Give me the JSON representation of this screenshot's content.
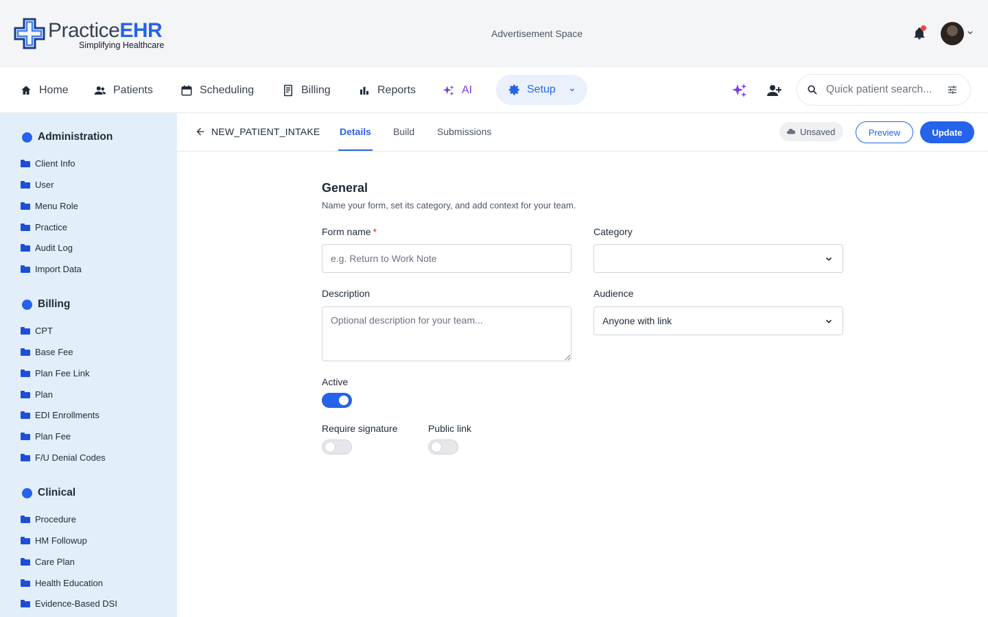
{
  "app": {
    "brand_practice": "Practice",
    "brand_ehr": "EHR",
    "tagline": "Simplifying Healthcare",
    "ad_space": "Advertisement Space"
  },
  "nav": {
    "home": "Home",
    "patients": "Patients",
    "scheduling": "Scheduling",
    "billing": "Billing",
    "reports": "Reports",
    "ai": "AI",
    "setup": "Setup",
    "search_placeholder": "Quick patient search..."
  },
  "sidebar": {
    "sections": [
      {
        "title": "Administration",
        "items": [
          "Client Info",
          "User",
          "Menu Role",
          "Practice",
          "Audit Log",
          "Import Data"
        ]
      },
      {
        "title": "Billing",
        "items": [
          "CPT",
          "Base Fee",
          "Plan Fee Link",
          "Plan",
          "EDI Enrollments",
          "Plan Fee",
          "F/U Denial Codes"
        ]
      },
      {
        "title": "Clinical",
        "items": [
          "Procedure",
          "HM Followup",
          "Care Plan",
          "Health Education",
          "Evidence-Based DSI"
        ]
      }
    ]
  },
  "subheader": {
    "form_id": "NEW_PATIENT_INTAKE",
    "tabs": [
      "Details",
      "Build",
      "Submissions"
    ],
    "active_tab": "Details",
    "status": "Unsaved",
    "preview_label": "Preview",
    "update_label": "Update"
  },
  "form": {
    "section_title": "General",
    "section_subtitle": "Name your form, set its category, and add context for your team.",
    "form_name_label": "Form name",
    "form_name_required": "*",
    "form_name_placeholder": "e.g. Return to Work Note",
    "category_label": "Category",
    "category_value": "",
    "description_label": "Description",
    "description_placeholder": "Optional description for your team...",
    "audience_label": "Audience",
    "audience_value": "Anyone with link",
    "active_label": "Active",
    "active": true,
    "require_signature_label": "Require signature",
    "require_signature": false,
    "public_link_label": "Public link",
    "public_link": false
  },
  "colors": {
    "accent": "#2563eb",
    "sidebar_bg": "#e3eefb",
    "ai_purple": "#7c3aed",
    "notification_dot": "#ef4444"
  }
}
